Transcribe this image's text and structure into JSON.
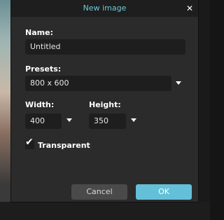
{
  "dialog": {
    "title": "New image",
    "close_glyph": "✕",
    "name_label": "Name",
    "name_value": "Untitled",
    "presets_label": "Presets",
    "presets_value": "800 x 600",
    "width_label": "Width",
    "width_value": "400",
    "height_label": "Height",
    "height_value": "350",
    "transparent_label": "Transparent",
    "transparent_checked": true,
    "cancel_label": "Cancel",
    "ok_label": "OK"
  },
  "colors": {
    "title": "#6fc8d8",
    "ok_button": "#64c0d8",
    "dialog_bg": "#2b2b2b",
    "input_bg": "#1e1e1e"
  },
  "icons": [
    "close-icon",
    "chevron-down-icon",
    "checkmark-icon"
  ]
}
